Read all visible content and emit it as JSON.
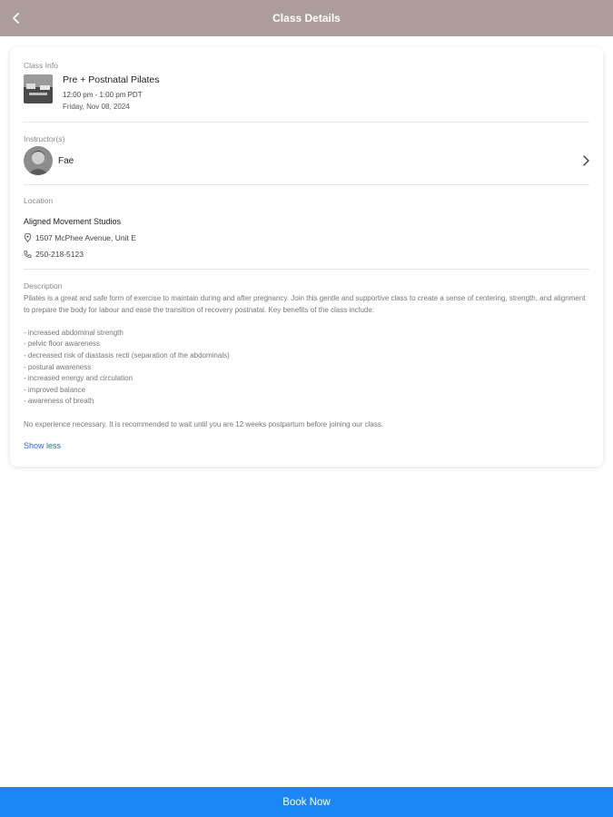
{
  "header": {
    "title": "Class Details"
  },
  "class_info": {
    "section_label": "Class Info",
    "name": "Pre + Postnatal Pilates",
    "time": "12:00 pm - 1:00 pm PDT",
    "date": "Friday, Nov 08, 2024"
  },
  "instructors": {
    "section_label": "Instructor(s)",
    "items": [
      {
        "name": "Fae"
      }
    ]
  },
  "location": {
    "section_label": "Location",
    "studio": "Aligned Movement Studios",
    "address": "1507 McPhee Avenue, Unit E",
    "phone": "250-218-5123"
  },
  "description": {
    "section_label": "Description",
    "intro": "Pilates is a great and safe form of exercise to maintain during and after pregnancy. Join this gentle and supportive class to create a sense of centering, strength, and alignment to prepare the body for labour and ease the transition of recovery postnatal. Key benefits of the class include:",
    "benefits": [
      "- increased abdominal strength",
      "- pelvic floor awareness",
      "- decreased risk of diastasis recti (separation of the abdominals)",
      "- postural awareness",
      "- increased energy and circulation",
      "- improved balance",
      "- awareness of breath"
    ],
    "note": "No experience necessary. It is recommended to wait until you are 12 weeks postpartum before joining our class.",
    "toggle_label": "Show less"
  },
  "footer": {
    "book_label": "Book Now"
  },
  "colors": {
    "header_bg": "#ad9e9b",
    "primary_button": "#1b87f7",
    "link": "#2a63d6"
  },
  "icons": {
    "back": "chevron-left-icon",
    "instructor_arrow": "chevron-right-icon",
    "address": "map-pin-icon",
    "phone": "phone-icon"
  }
}
